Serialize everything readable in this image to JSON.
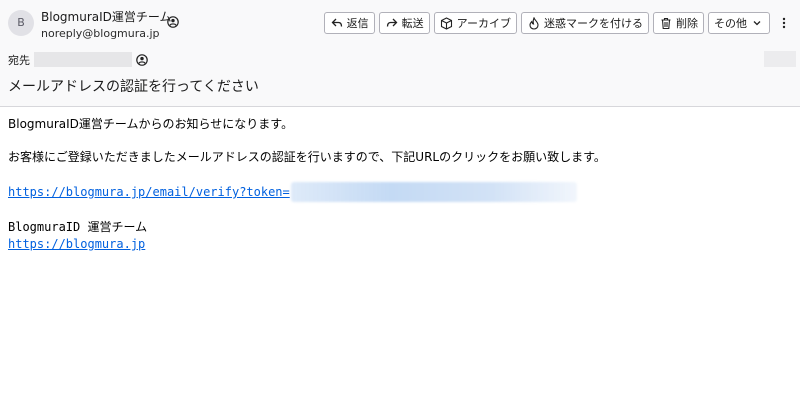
{
  "sender": {
    "avatar_initial": "B",
    "name": "BlogmuraID運営チーム",
    "email": "noreply@blogmura.jp"
  },
  "toolbar": {
    "reply": "返信",
    "forward": "転送",
    "archive": "アーカイブ",
    "junk": "迷惑マークを付ける",
    "delete": "削除",
    "other": "その他"
  },
  "recipient": {
    "label": "宛先"
  },
  "subject": "メールアドレスの認証を行ってください",
  "body": {
    "line1": "BlogmuraID運営チームからのお知らせになります。",
    "line2": "お客様にご登録いただきましたメールアドレスの認証を行いますので、下記URLのクリックをお願い致します。",
    "verify_link": "https://blogmura.jp/email/verify?token=",
    "signature_name": "BlogmuraID 運営チーム",
    "signature_link": "https://blogmura.jp"
  },
  "icons": {
    "avatar": "avatar-initial",
    "contact": "person-icon",
    "reply": "reply-icon",
    "forward": "forward-icon",
    "archive": "archive-icon",
    "junk": "flame-icon",
    "delete": "trash-icon",
    "dropdown": "chevron-down-icon",
    "overflow": "more-icon"
  },
  "colors": {
    "link": "#0060df",
    "header_bg": "#f9f9fa"
  }
}
